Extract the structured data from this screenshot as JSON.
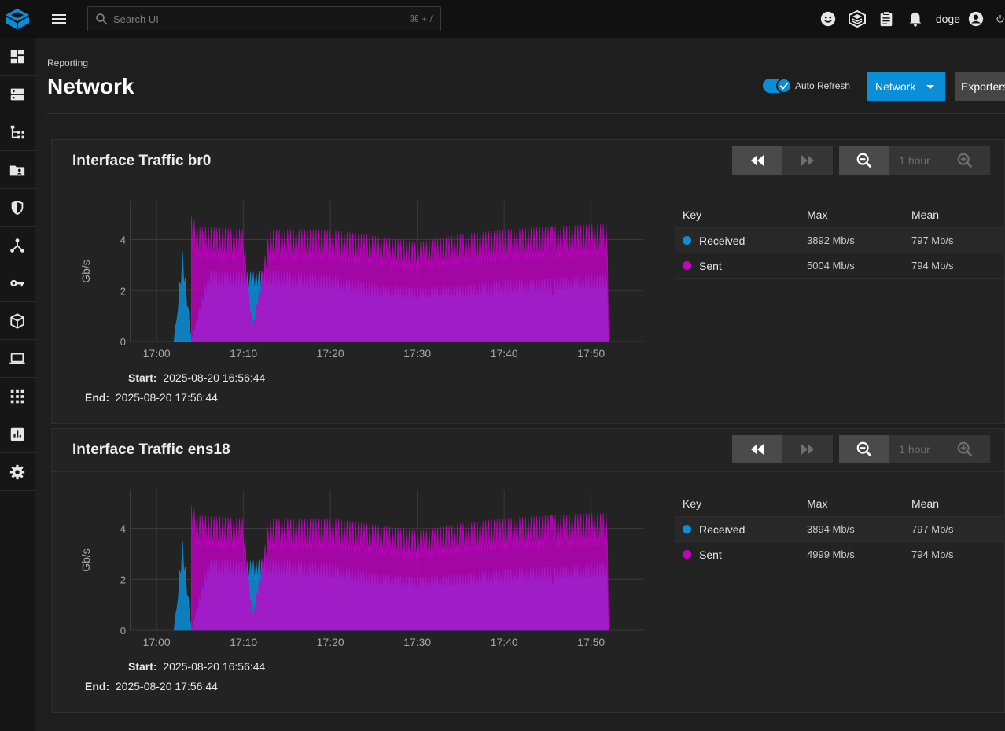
{
  "topbar": {
    "search_placeholder": "Search UI",
    "search_shortcut": "⌘ + /",
    "username": "doge",
    "icons": [
      "truecommand-icon",
      "jobs-icon",
      "clipboard-icon",
      "bell-icon",
      "account-icon",
      "power-icon"
    ]
  },
  "sidebar": {
    "items": [
      "dashboard-icon",
      "storage-icon",
      "datasets-icon",
      "shares-icon",
      "data-protection-icon",
      "network-icon",
      "credentials-icon",
      "apps-icon",
      "virtualization-icon",
      "system-icon",
      "reporting-icon",
      "settings-icon"
    ]
  },
  "page": {
    "breadcrumb": "Reporting",
    "title": "Network",
    "auto_refresh_label": "Auto Refresh",
    "auto_refresh_on": true,
    "network_button": "Network",
    "exporters_button": "Exporters",
    "accent": "#0b8ed8"
  },
  "cards": [
    {
      "title": "Interface Traffic br0",
      "zoom_label": "1 hour",
      "start_label": "Start:",
      "start_value": "2025-08-20 16:56:44",
      "end_label": "End:",
      "end_value": "2025-08-20 17:56:44",
      "legend": {
        "headers": [
          "Key",
          "Max",
          "Mean"
        ],
        "rows": [
          {
            "name": "Received",
            "color": "#0b8ed8",
            "max": "3892 Mb/s",
            "mean": "797 Mb/s"
          },
          {
            "name": "Sent",
            "color": "#c800c8",
            "max": "5004 Mb/s",
            "mean": "794 Mb/s"
          }
        ]
      }
    },
    {
      "title": "Interface Traffic ens18",
      "zoom_label": "1 hour",
      "start_label": "Start:",
      "start_value": "2025-08-20 16:56:44",
      "end_label": "End:",
      "end_value": "2025-08-20 17:56:44",
      "legend": {
        "headers": [
          "Key",
          "Max",
          "Mean"
        ],
        "rows": [
          {
            "name": "Received",
            "color": "#0b8ed8",
            "max": "3894 Mb/s",
            "mean": "797 Mb/s"
          },
          {
            "name": "Sent",
            "color": "#c800c8",
            "max": "4999 Mb/s",
            "mean": "794 Mb/s"
          }
        ]
      }
    }
  ],
  "chart_data": [
    {
      "type": "area",
      "ylabel": "Gb/s",
      "ylim": [
        0,
        5.5
      ],
      "yticks": [
        0,
        2,
        4
      ],
      "xlim": [
        "16:57",
        "17:56"
      ],
      "xticks": [
        "17:00",
        "17:10",
        "17:20",
        "17:30",
        "17:40",
        "17:50"
      ],
      "grid": true,
      "series": [
        {
          "name": "Received",
          "color": "#0b8ed8",
          "x": [
            "17:02",
            "17:03",
            "17:04",
            "17:06",
            "17:10",
            "17:13",
            "17:20",
            "17:26",
            "17:30",
            "17:35",
            "17:40",
            "17:45",
            "17:50",
            "17:52"
          ],
          "values": [
            0,
            3.6,
            0,
            2.8,
            2.7,
            2.8,
            2.6,
            2.2,
            2.1,
            2.2,
            2.4,
            2.5,
            2.6,
            2.7
          ]
        },
        {
          "name": "Sent",
          "color": "#c800c8",
          "x": [
            "17:04",
            "17:05",
            "17:10",
            "17:11",
            "17:13",
            "17:20",
            "17:26",
            "17:30",
            "17:35",
            "17:40",
            "17:45",
            "17:50",
            "17:52"
          ],
          "values": [
            4.9,
            4.5,
            4.4,
            0.5,
            4.4,
            4.4,
            4.1,
            3.9,
            4.2,
            4.4,
            4.5,
            4.6,
            4.6
          ]
        }
      ]
    },
    {
      "type": "area",
      "ylabel": "Gb/s",
      "ylim": [
        0,
        5.5
      ],
      "yticks": [
        0,
        2,
        4
      ],
      "xlim": [
        "16:57",
        "17:56"
      ],
      "xticks": [
        "17:00",
        "17:10",
        "17:20",
        "17:30",
        "17:40",
        "17:50"
      ],
      "grid": true,
      "series": [
        {
          "name": "Received",
          "color": "#0b8ed8",
          "x": [
            "17:02",
            "17:03",
            "17:04",
            "17:06",
            "17:10",
            "17:13",
            "17:20",
            "17:26",
            "17:30",
            "17:35",
            "17:40",
            "17:45",
            "17:50",
            "17:52"
          ],
          "values": [
            0,
            3.6,
            0,
            2.8,
            2.7,
            2.8,
            2.6,
            2.2,
            2.1,
            2.2,
            2.4,
            2.5,
            2.6,
            2.7
          ]
        },
        {
          "name": "Sent",
          "color": "#c800c8",
          "x": [
            "17:04",
            "17:05",
            "17:10",
            "17:11",
            "17:13",
            "17:20",
            "17:26",
            "17:30",
            "17:35",
            "17:40",
            "17:45",
            "17:50",
            "17:52"
          ],
          "values": [
            4.9,
            4.5,
            4.4,
            0.5,
            4.4,
            4.4,
            4.1,
            3.9,
            4.2,
            4.4,
            4.5,
            4.6,
            4.6
          ]
        }
      ]
    }
  ]
}
